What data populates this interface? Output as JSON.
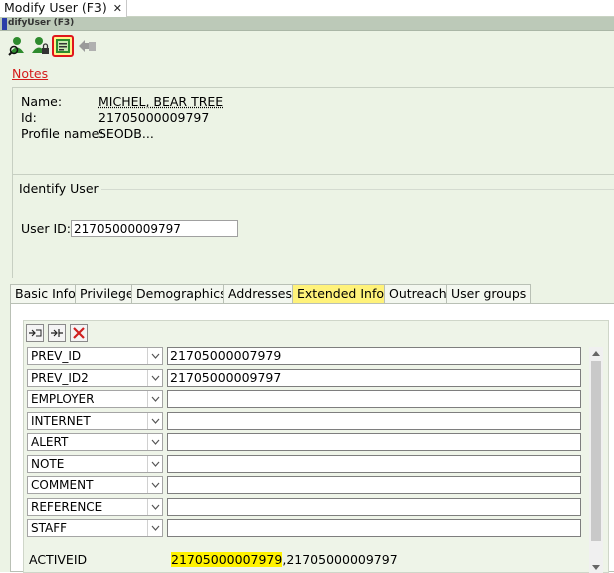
{
  "doc_tab": {
    "label": "Modify User (F3)",
    "close": "✕"
  },
  "window_title": "difyUser (F3)",
  "notes_link": "Notes",
  "user_info": {
    "name_label": "Name:",
    "name_value": "MICHEL, BEAR TREE",
    "id_label": "Id:",
    "id_value": "21705000009797",
    "profile_label": "Profile name:",
    "profile_value": "SEODB..."
  },
  "identify": {
    "title": "Identify User",
    "user_id_label": "User ID:",
    "user_id_value": "21705000009797"
  },
  "tabs": [
    {
      "label": "Basic Info"
    },
    {
      "label": "Privilege"
    },
    {
      "label": "Demographics"
    },
    {
      "label": "Addresses"
    },
    {
      "label": "Extended Info"
    },
    {
      "label": "Outreach"
    },
    {
      "label": "User groups"
    }
  ],
  "extended_rows": [
    {
      "field": "PREV_ID",
      "value": "21705000007979"
    },
    {
      "field": "PREV_ID2",
      "value": "21705000009797"
    },
    {
      "field": "EMPLOYER",
      "value": ""
    },
    {
      "field": "INTERNET",
      "value": ""
    },
    {
      "field": "ALERT",
      "value": ""
    },
    {
      "field": "NOTE",
      "value": ""
    },
    {
      "field": "COMMENT",
      "value": ""
    },
    {
      "field": "REFERENCE",
      "value": ""
    },
    {
      "field": "STAFF",
      "value": ""
    }
  ],
  "active_id": {
    "label": "ACTIVEID",
    "value_highlight": "21705000007979",
    "value_rest": ",21705000009797"
  },
  "colors": {
    "highlight": "#fff200",
    "notes_link": "#d41b1b",
    "highlight_border": "#e0151c"
  }
}
